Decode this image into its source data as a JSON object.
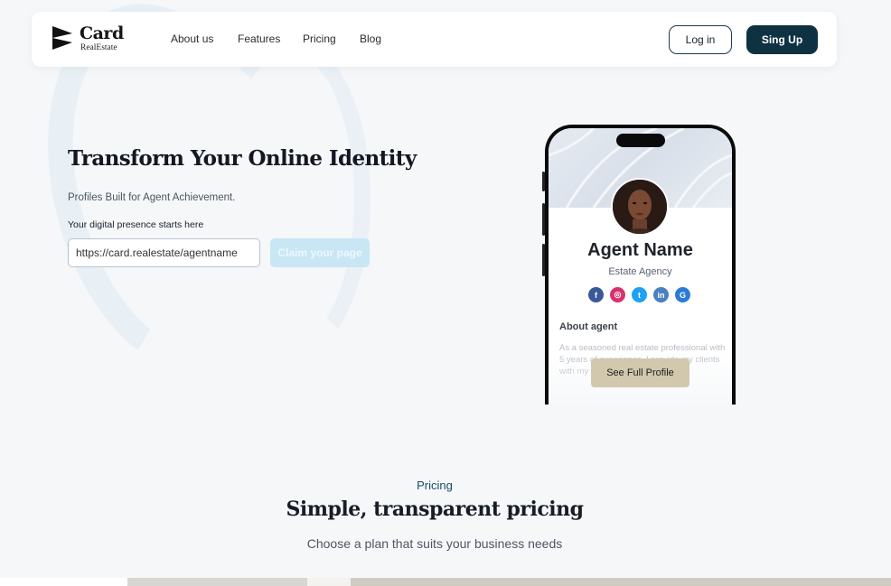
{
  "nav": {
    "logo_title": "Card",
    "logo_subtitle": "RealEstate",
    "links": [
      "About us",
      "Features",
      "Pricing",
      "Blog"
    ],
    "login_label": "Log in",
    "signup_label": "Sing Up"
  },
  "hero": {
    "title": "Transform Your Online Identity",
    "subtitle": "Profiles Built for Agent Achievement.",
    "input_label": "Your digital presence starts here",
    "input_value": "https://card.realestate/agentname",
    "claim_label": "Claim your page"
  },
  "profile": {
    "agent_name": "Agent Name",
    "agency": "Estate Agency",
    "socials": [
      {
        "icon": "facebook-icon",
        "glyph": "f",
        "color": "#3b5998"
      },
      {
        "icon": "instagram-icon",
        "glyph": "◎",
        "color": "#d6336c"
      },
      {
        "icon": "twitter-icon",
        "glyph": "t",
        "color": "#1da1f2"
      },
      {
        "icon": "linkedin-icon",
        "glyph": "in",
        "color": "#4a7fc1"
      },
      {
        "icon": "google-icon",
        "glyph": "G",
        "color": "#2b7bd6"
      }
    ],
    "about_label": "About agent",
    "about_text": "As a seasoned real estate professional with 5 years of experience, I provide my clients with my",
    "full_profile_label": "See Full Profile"
  },
  "pricing": {
    "label": "Pricing",
    "title": "Simple, transparent pricing",
    "subtitle": "Choose a plan that suits your business needs"
  },
  "colors": {
    "primary_dark": "#0f3242",
    "claim_button": "#c9e6f5",
    "profile_button": "#d2c8ad"
  }
}
